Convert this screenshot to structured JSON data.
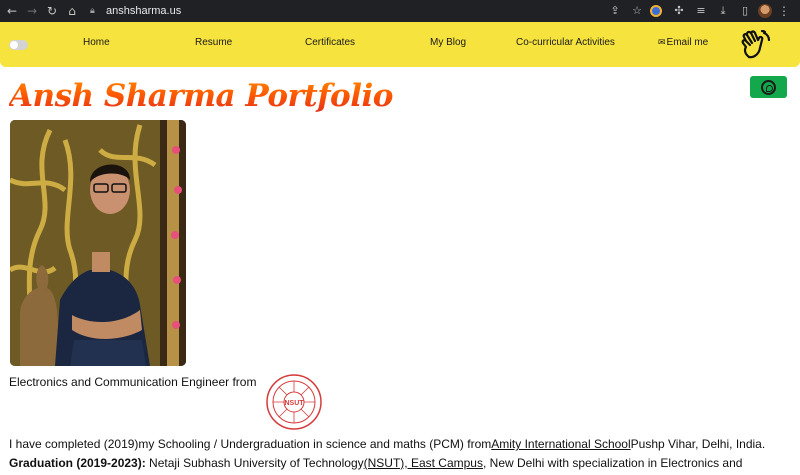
{
  "browser": {
    "url": "anshsharma.us",
    "icons": [
      "back-arrow",
      "forward-arrow",
      "reload",
      "home",
      "lock",
      "share",
      "star",
      "extension-badge",
      "puzzle",
      "reading-list",
      "download",
      "side-panel",
      "profile",
      "menu"
    ]
  },
  "nav": {
    "items": [
      "Home",
      "Resume",
      "Certificates",
      "My Blog",
      "Co-curricular Activities",
      "Email me"
    ],
    "toggle_state": "off",
    "accent_color": "#f6e33d"
  },
  "hero": {
    "title": "Ansh Sharma Portfolio",
    "title_colors": [
      "#ff8a00",
      "#e12d1f"
    ],
    "whatsapp_color": "#12a84b"
  },
  "content": {
    "intro": "Electronics and Communication Engineer from",
    "logo_text": "NSUT",
    "para1": {
      "before": "I have completed (2019)my Schooling / Undergraduation in science and maths (PCM) from",
      "link": "Amity International School",
      "after": "Pushp Vihar, Delhi, India."
    },
    "para2": {
      "label": "Graduation (2019-2023):",
      "text1": " Netaji Subhash University of Technology",
      "link": "(NSUT), East Campus",
      "text2": ", New Delhi with specialization in Electronics and"
    }
  }
}
